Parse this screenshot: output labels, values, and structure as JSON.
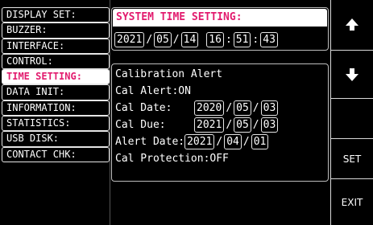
{
  "menu": {
    "items": [
      {
        "label": "DISPLAY SET:"
      },
      {
        "label": "BUZZER:"
      },
      {
        "label": "INTERFACE:"
      },
      {
        "label": "CONTROL:"
      },
      {
        "label": "TIME SETTING:"
      },
      {
        "label": "DATA INIT:"
      },
      {
        "label": "INFORMATION:"
      },
      {
        "label": "STATISTICS:"
      },
      {
        "label": "USB DISK:"
      },
      {
        "label": "CONTACT CHK:"
      }
    ],
    "active": "TIME SETTING:"
  },
  "system_time": {
    "title": "SYSTEM TIME SETTING:",
    "year": "2021",
    "month": "05",
    "day": "14",
    "hour": "16",
    "minute": "51",
    "second": "43"
  },
  "calibration": {
    "title": "Calibration Alert",
    "alert_label": "Cal Alert:",
    "alert_value": "ON",
    "date_label": "Cal Date:",
    "date": {
      "year": "2020",
      "month": "05",
      "day": "03"
    },
    "due_label": "Cal Due:",
    "due": {
      "year": "2021",
      "month": "05",
      "day": "03"
    },
    "alert_date_label": "Alert Date:",
    "alert_date": {
      "year": "2021",
      "month": "04",
      "day": "01"
    },
    "protection_label": "Cal Protection:",
    "protection_value": "OFF"
  },
  "separators": {
    "date": "/",
    "time": ":"
  },
  "softkeys": {
    "up_icon": "arrow-up-icon",
    "down_icon": "arrow-down-icon",
    "set": "SET",
    "exit": "EXIT"
  },
  "colors": {
    "accent": "#e21b6e",
    "background": "#000000",
    "highlight": "#ffffff"
  }
}
